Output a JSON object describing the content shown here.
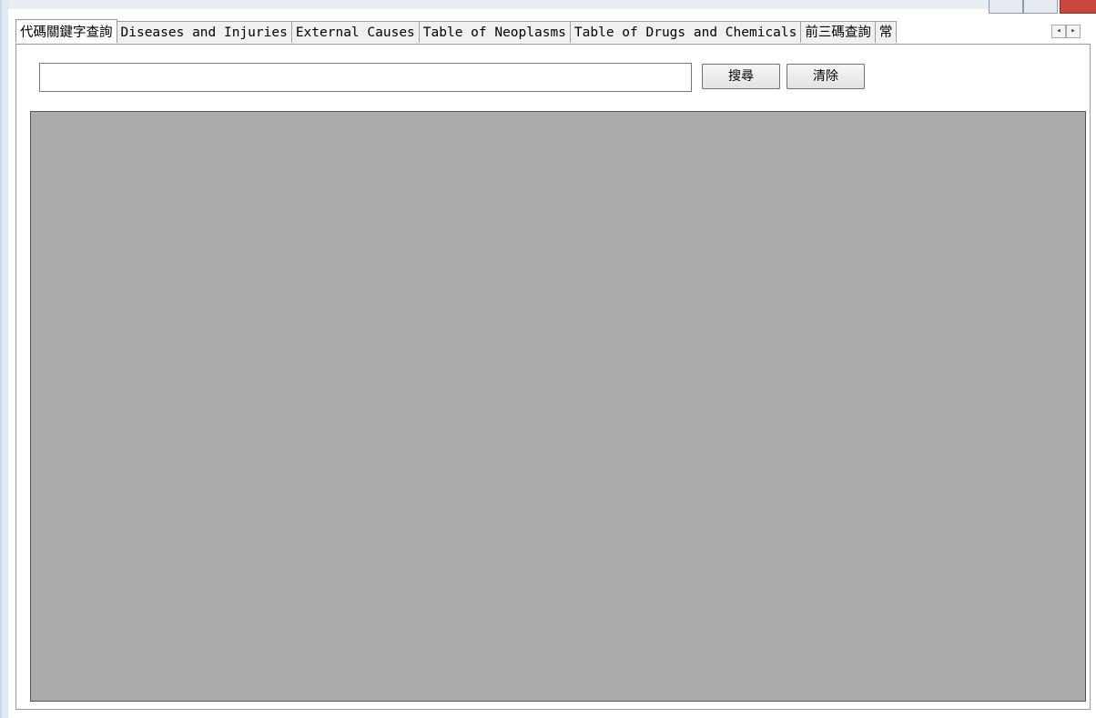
{
  "tabs": [
    {
      "label": "代碼關鍵字查詢",
      "active": true
    },
    {
      "label": "Diseases and Injuries",
      "active": false
    },
    {
      "label": "External Causes",
      "active": false
    },
    {
      "label": "Table of Neoplasms",
      "active": false
    },
    {
      "label": "Table of Drugs and Chemicals",
      "active": false
    },
    {
      "label": "前三碼查詢",
      "active": false
    },
    {
      "label": "常",
      "active": false
    }
  ],
  "tab_scroll": {
    "left_icon": "◂",
    "right_icon": "▸"
  },
  "search": {
    "value": "",
    "placeholder": ""
  },
  "buttons": {
    "search_label": "搜尋",
    "clear_label": "清除"
  },
  "colors": {
    "results_background": "#ababab",
    "caption_close": "#c9463d"
  }
}
